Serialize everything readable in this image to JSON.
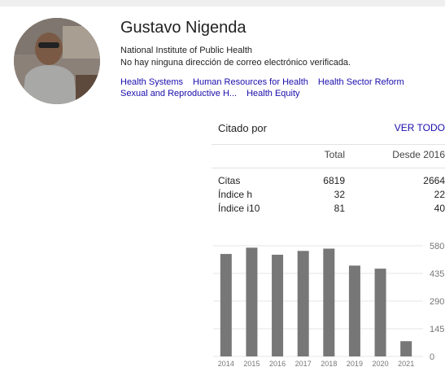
{
  "profile": {
    "name": "Gustavo Nigenda",
    "affiliation": "National Institute of Public Health",
    "email_status": "No hay ninguna dirección de correo electrónico verificada.",
    "interests": [
      "Health Systems",
      "Human Resources for Health",
      "Health Sector Reform",
      "Sexual and Reproductive H...",
      "Health Equity"
    ]
  },
  "cited_by": {
    "title": "Citado por",
    "view_all": "VER TODO",
    "col_total": "Total",
    "col_since": "Desde 2016",
    "rows": [
      {
        "label": "Citas",
        "total": "6819",
        "since": "2664"
      },
      {
        "label": "Índice h",
        "total": "32",
        "since": "22"
      },
      {
        "label": "Índice i10",
        "total": "81",
        "since": "40"
      }
    ]
  },
  "chart_data": {
    "type": "bar",
    "categories": [
      "2014",
      "2015",
      "2016",
      "2017",
      "2018",
      "2019",
      "2020",
      "2021"
    ],
    "values": [
      537,
      570,
      533,
      553,
      565,
      476,
      460,
      80
    ],
    "yticks": [
      0,
      145,
      290,
      435,
      580
    ],
    "ylim": [
      0,
      580
    ],
    "bar_color": "#777777"
  }
}
